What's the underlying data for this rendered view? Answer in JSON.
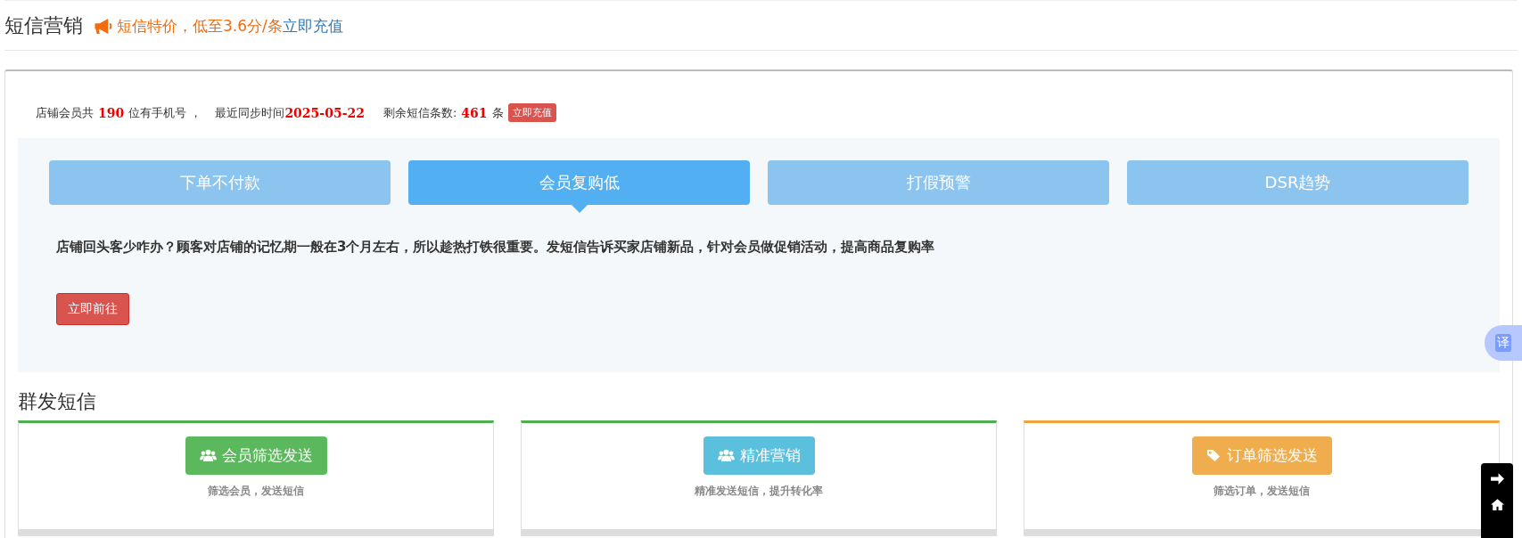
{
  "header": {
    "title": "短信营销",
    "promo": "短信特价，低至3.6分/条",
    "promo_link": "立即充值"
  },
  "info": {
    "members_prefix": "店铺会员共",
    "member_count": "190",
    "members_suffix": "位有手机号 ，",
    "sync_label": "最近同步时间",
    "sync_date": "2025-05-22",
    "remaining_label": "剩余短信条数:",
    "remaining_count": "461",
    "remaining_unit": "条",
    "recharge_button": "立即充值"
  },
  "tabs": [
    {
      "label": "下单不付款",
      "selected": false
    },
    {
      "label": "会员复购低",
      "selected": true
    },
    {
      "label": "打假预警",
      "selected": false
    },
    {
      "label": "DSR趋势",
      "selected": false
    }
  ],
  "tab_panel": {
    "description": "店铺回头客少咋办？顾客对店铺的记忆期一般在3个月左右，所以趁热打铁很重要。发短信告诉买家店铺新品，针对会员做促销活动，提高商品复购率",
    "button": "立即前往"
  },
  "section_title": "群发短信",
  "cards": [
    {
      "color": "#4cae4c",
      "button": {
        "kind": "member",
        "label": "会员筛选发送"
      },
      "caption": "筛选会员，发送短信"
    },
    {
      "color": "#4cae4c",
      "button": {
        "kind": "precise",
        "label": "精准营销"
      },
      "caption": "精准发送短信，提升转化率"
    },
    {
      "color": "#f0a33b",
      "button": {
        "kind": "order",
        "label": "订单筛选发送"
      },
      "caption": "筛选订单，发送短信"
    }
  ],
  "translate_widget": {
    "label": "译"
  }
}
